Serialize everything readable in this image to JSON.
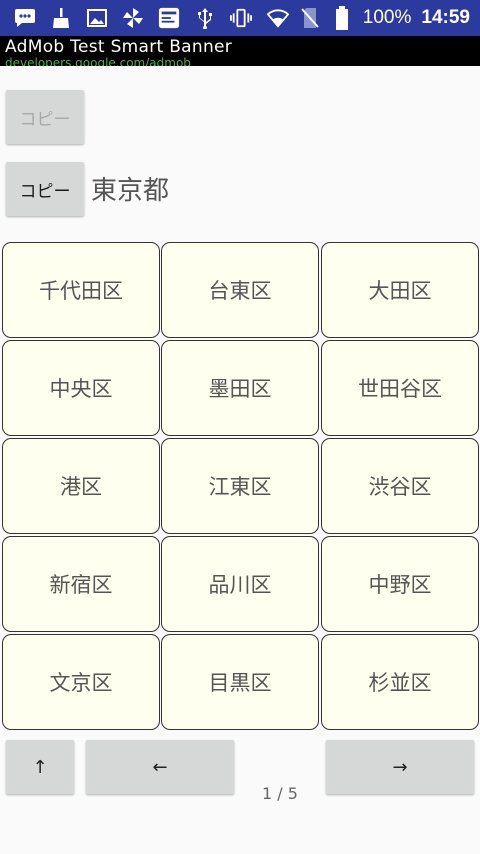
{
  "status_bar": {
    "battery_percent": "100%",
    "time": "14:59",
    "icons": [
      "message-icon",
      "broom-icon",
      "image-icon",
      "pinwheel-icon",
      "news-app-icon",
      "usb-icon",
      "vibrate-icon",
      "wifi-icon",
      "no-sim-icon",
      "battery-icon"
    ]
  },
  "ad_banner": {
    "title": "AdMob Test Smart Banner",
    "url": "developers.google.com/admob"
  },
  "copy_top": {
    "label": "コピー",
    "enabled": false
  },
  "copy_main": {
    "label": "コピー",
    "enabled": true
  },
  "prefecture": "東京都",
  "wards": [
    [
      "千代田区",
      "台東区",
      "大田区"
    ],
    [
      "中央区",
      "墨田区",
      "世田谷区"
    ],
    [
      "港区",
      "江東区",
      "渋谷区"
    ],
    [
      "新宿区",
      "品川区",
      "中野区"
    ],
    [
      "文京区",
      "目黒区",
      "杉並区"
    ]
  ],
  "nav": {
    "up_label": "↑",
    "prev_label": "←",
    "next_label": "→",
    "page_indicator": "1 / 5"
  },
  "colors": {
    "status_bar": "#2b3a9c",
    "ad_banner_bg": "#000000",
    "ad_url": "#4caf50",
    "cell_bg": "#fffff0",
    "button_bg": "#d6d7d7"
  }
}
